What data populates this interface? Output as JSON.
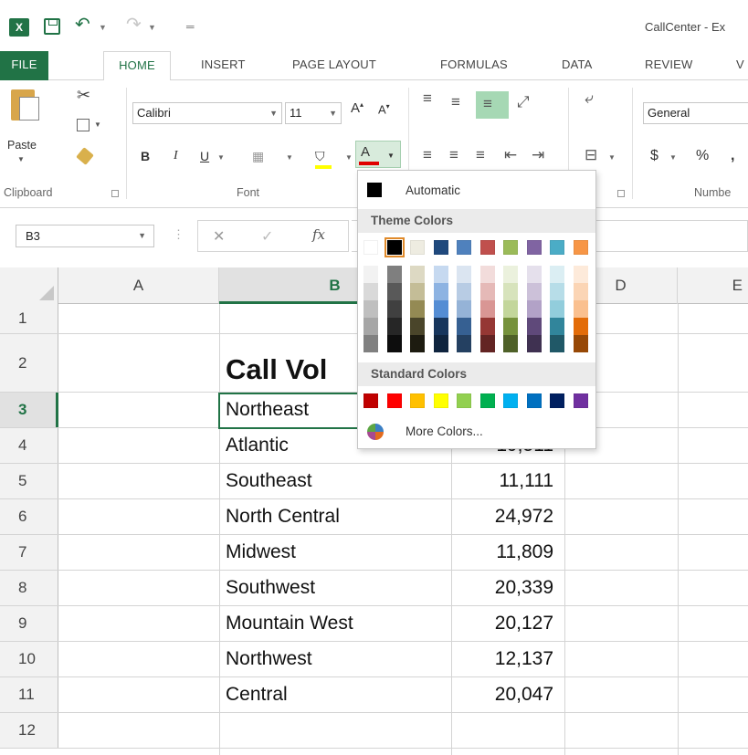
{
  "window": {
    "title": "CallCenter - Ex"
  },
  "ribbon_tabs": [
    {
      "id": "file",
      "label": "FILE"
    },
    {
      "id": "home",
      "label": "HOME"
    },
    {
      "id": "insert",
      "label": "INSERT"
    },
    {
      "id": "page_layout",
      "label": "PAGE LAYOUT"
    },
    {
      "id": "formulas",
      "label": "FORMULAS"
    },
    {
      "id": "data",
      "label": "DATA"
    },
    {
      "id": "review",
      "label": "REVIEW"
    },
    {
      "id": "view",
      "label": "V"
    }
  ],
  "active_tab": "home",
  "clipboard": {
    "paste_label": "Paste",
    "group_label": "Clipboard"
  },
  "font": {
    "name": "Calibri",
    "size": "11",
    "bold": "B",
    "italic": "I",
    "underline": "U",
    "font_color_letter": "A",
    "group_label": "Font",
    "highlight_color": "#ffff00",
    "font_color": "#e00000"
  },
  "number": {
    "format": "General",
    "currency": "$",
    "percent": "%",
    "comma": ",",
    "group_label": "Numbe"
  },
  "formula_bar": {
    "name_box": "B3",
    "fx_label": "fx",
    "formula": ""
  },
  "columns": [
    "A",
    "B",
    "C",
    "D",
    "E"
  ],
  "selected_column": "B",
  "selected_row": "3",
  "rows": [
    {
      "num": "1",
      "b": "",
      "c": ""
    },
    {
      "num": "2",
      "b": "Call Vol",
      "c": ""
    },
    {
      "num": "3",
      "b": "Northeast",
      "c": ""
    },
    {
      "num": "4",
      "b": "Atlantic",
      "c": "19,511"
    },
    {
      "num": "5",
      "b": "Southeast",
      "c": "11,111"
    },
    {
      "num": "6",
      "b": "North Central",
      "c": "24,972"
    },
    {
      "num": "7",
      "b": "Midwest",
      "c": "11,809"
    },
    {
      "num": "8",
      "b": "Southwest",
      "c": "20,339"
    },
    {
      "num": "9",
      "b": "Mountain West",
      "c": "20,127"
    },
    {
      "num": "10",
      "b": "Northwest",
      "c": "12,137"
    },
    {
      "num": "11",
      "b": "Central",
      "c": "20,047"
    },
    {
      "num": "12",
      "b": "",
      "c": ""
    }
  ],
  "font_color_menu": {
    "automatic_label": "Automatic",
    "theme_colors_label": "Theme Colors",
    "standard_colors_label": "Standard Colors",
    "more_colors_label": "More Colors...",
    "theme_top": [
      "#ffffff",
      "#000000",
      "#e7e6e6",
      "#44546a",
      "#4472c4",
      "#ed7d31",
      "#a5a5a5",
      "#ffc000",
      "#5b9bd5",
      "#70ad47"
    ],
    "theme_top_display": [
      "#ffffff",
      "#000000",
      "#eeece1",
      "#1f497d",
      "#4f81bd",
      "#c0504d",
      "#9bbb59",
      "#8064a2",
      "#4bacc6",
      "#f79646"
    ],
    "theme_shades": [
      [
        "#f2f2f2",
        "#d9d9d9",
        "#bfbfbf",
        "#a6a6a6",
        "#808080"
      ],
      [
        "#7f7f7f",
        "#595959",
        "#404040",
        "#262626",
        "#0d0d0d"
      ],
      [
        "#ddd9c3",
        "#c4bd97",
        "#948a54",
        "#4a452a",
        "#1d1b10"
      ],
      [
        "#c6d9f0",
        "#8db3e2",
        "#548dd4",
        "#17365d",
        "#0f243e"
      ],
      [
        "#dbe5f1",
        "#b8cce4",
        "#95b3d7",
        "#366092",
        "#244061"
      ],
      [
        "#f2dcdb",
        "#e5b9b7",
        "#d99694",
        "#953734",
        "#632423"
      ],
      [
        "#ebf1dd",
        "#d7e3bc",
        "#c3d69b",
        "#76923c",
        "#4f6128"
      ],
      [
        "#e5e0ec",
        "#ccc1d9",
        "#b2a2c7",
        "#5f497a",
        "#3f3151"
      ],
      [
        "#dbeef3",
        "#b7dde8",
        "#92cddc",
        "#31859b",
        "#205867"
      ],
      [
        "#fdeada",
        "#fbd5b5",
        "#fac08f",
        "#e36c09",
        "#974806"
      ]
    ],
    "standard": [
      "#c00000",
      "#ff0000",
      "#ffc000",
      "#ffff00",
      "#92d050",
      "#00b050",
      "#00b0f0",
      "#0070c0",
      "#002060",
      "#7030a0"
    ],
    "selected_theme_index": 1
  },
  "icons": [
    "excel-logo-icon",
    "save-icon",
    "undo-icon",
    "redo-icon",
    "cut-icon",
    "copy-icon",
    "format-painter-icon",
    "paste-icon",
    "font-color-icon",
    "highlight-icon",
    "borders-icon",
    "more-colors-icon"
  ]
}
